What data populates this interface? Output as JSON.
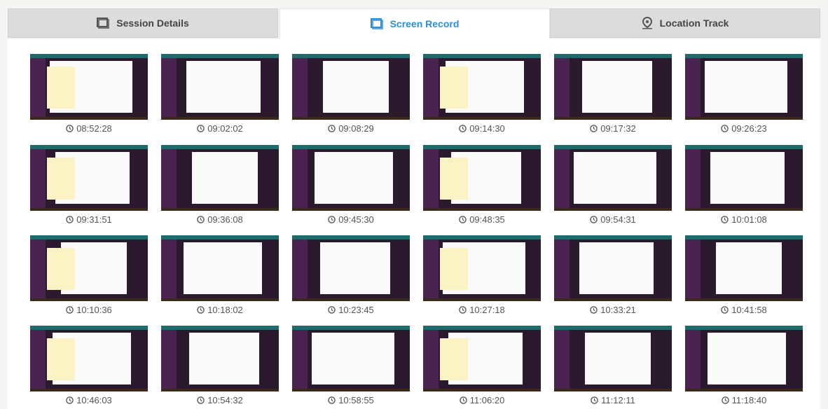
{
  "tabs": [
    {
      "label": "Session Details",
      "icon": "window-icon",
      "active": false
    },
    {
      "label": "Screen Record",
      "icon": "window-icon",
      "active": true
    },
    {
      "label": "Location Track",
      "icon": "location-pin-icon",
      "active": false
    }
  ],
  "colors": {
    "accent": "#2a8fd6",
    "tab_inactive": "#dcdcdc",
    "text": "#444444"
  },
  "screenshots": [
    {
      "time": "08:52:28"
    },
    {
      "time": "09:02:02"
    },
    {
      "time": "09:08:29"
    },
    {
      "time": "09:14:30"
    },
    {
      "time": "09:17:32"
    },
    {
      "time": "09:26:23"
    },
    {
      "time": "09:31:51"
    },
    {
      "time": "09:36:08"
    },
    {
      "time": "09:45:30"
    },
    {
      "time": "09:48:35"
    },
    {
      "time": "09:54:31"
    },
    {
      "time": "10:01:08"
    },
    {
      "time": "10:10:36"
    },
    {
      "time": "10:18:02"
    },
    {
      "time": "10:23:45"
    },
    {
      "time": "10:27:18"
    },
    {
      "time": "10:33:21"
    },
    {
      "time": "10:41:58"
    },
    {
      "time": "10:46:03"
    },
    {
      "time": "10:54:32"
    },
    {
      "time": "10:58:55"
    },
    {
      "time": "11:06:20"
    },
    {
      "time": "11:12:11"
    },
    {
      "time": "11:18:40"
    }
  ]
}
